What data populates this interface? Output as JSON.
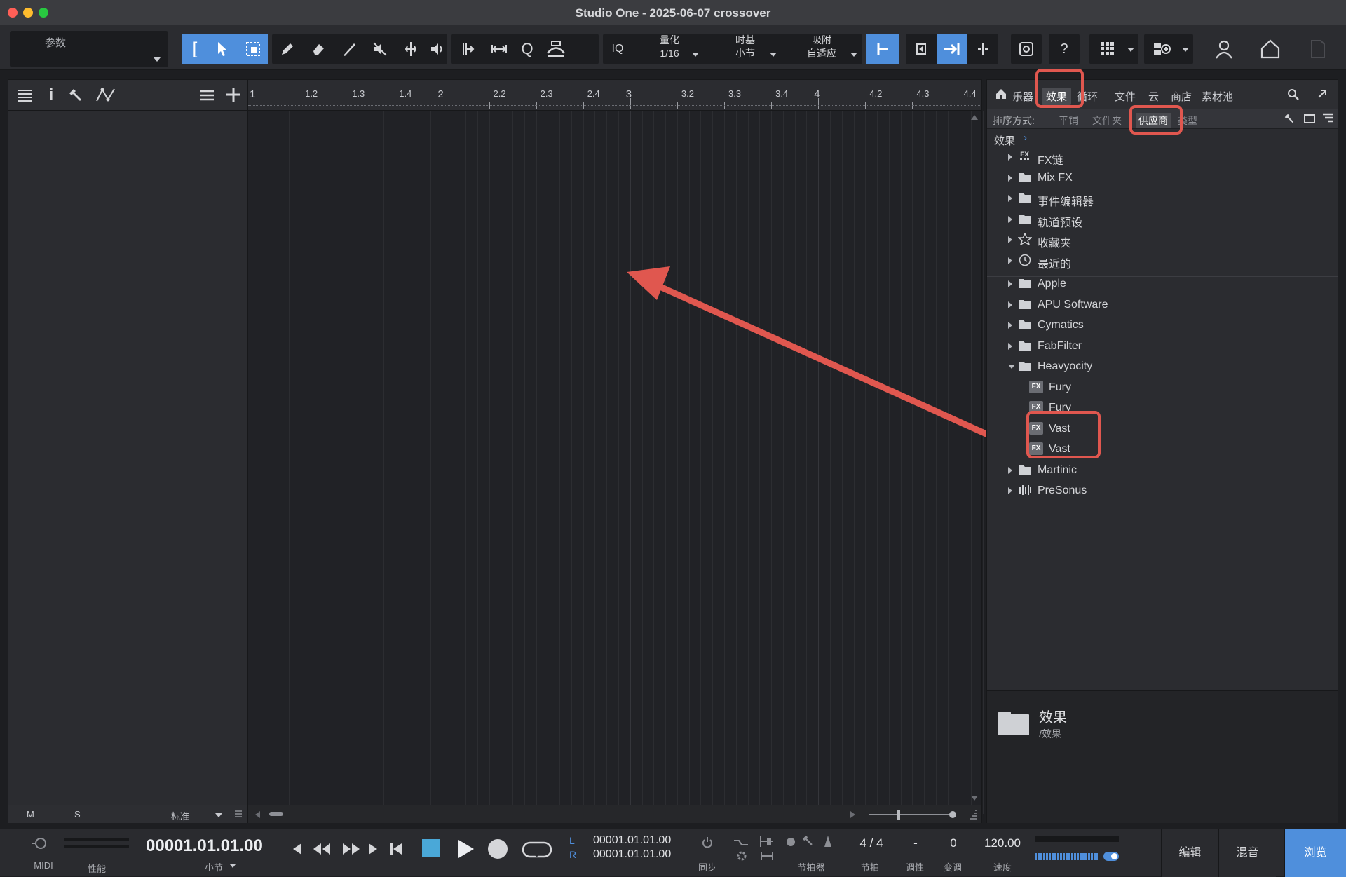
{
  "window": {
    "title": "Studio One - 2025-06-07 crossover"
  },
  "toolbar": {
    "params_label": "参数",
    "quantize_label": "量化",
    "quantize_value": "1/16",
    "timebase_label": "时基",
    "timebase_value": "小节",
    "snap_label": "吸附",
    "snap_value": "自适应",
    "iq_label": "IQ",
    "help_label": "?"
  },
  "ruler": {
    "labels": [
      "1",
      "1.2",
      "1.3",
      "1.4",
      "2",
      "2.2",
      "2.3",
      "2.4",
      "3",
      "3.2",
      "3.3",
      "3.4",
      "4",
      "4.2",
      "4.3",
      "4.4"
    ]
  },
  "left_footer": {
    "m": "M",
    "s": "S",
    "view": "标准"
  },
  "browser": {
    "tabs": [
      "乐器",
      "效果",
      "循环",
      "文件",
      "云",
      "商店",
      "素材池"
    ],
    "active_tab": "效果",
    "sort_label": "排序方式:",
    "sort_options": [
      "平铺",
      "文件夹",
      "供应商",
      "类型"
    ],
    "active_sort": "供应商",
    "breadcrumb": "效果",
    "items": [
      {
        "label": "FX链",
        "icon": "fx-chain-icon",
        "indent": 0,
        "expand": "closed"
      },
      {
        "label": "Mix FX",
        "icon": "folder-icon",
        "indent": 0,
        "expand": "closed"
      },
      {
        "label": "事件编辑器",
        "icon": "folder-icon",
        "indent": 0,
        "expand": "closed"
      },
      {
        "label": "轨道预设",
        "icon": "folder-icon",
        "indent": 0,
        "expand": "closed"
      },
      {
        "label": "收藏夹",
        "icon": "star-icon",
        "indent": 0,
        "expand": "closed"
      },
      {
        "label": "最近的",
        "icon": "clock-icon",
        "indent": 0,
        "expand": "closed"
      },
      {
        "label": "Apple",
        "icon": "folder-icon",
        "indent": 0,
        "expand": "closed"
      },
      {
        "label": "APU Software",
        "icon": "folder-icon",
        "indent": 0,
        "expand": "closed"
      },
      {
        "label": "Cymatics",
        "icon": "folder-icon",
        "indent": 0,
        "expand": "closed"
      },
      {
        "label": "FabFilter",
        "icon": "folder-icon",
        "indent": 0,
        "expand": "closed"
      },
      {
        "label": "Heavyocity",
        "icon": "folder-open-icon",
        "indent": 0,
        "expand": "open"
      },
      {
        "label": "Fury",
        "icon": "fx-plugin-icon",
        "indent": 1,
        "expand": "none"
      },
      {
        "label": "Fury",
        "icon": "fx-plugin-icon",
        "indent": 1,
        "expand": "none"
      },
      {
        "label": "Vast",
        "icon": "fx-plugin-icon",
        "indent": 1,
        "expand": "none"
      },
      {
        "label": "Vast",
        "icon": "fx-plugin-icon",
        "indent": 1,
        "expand": "none"
      },
      {
        "label": "Martinic",
        "icon": "folder-icon",
        "indent": 0,
        "expand": "closed"
      },
      {
        "label": "PreSonus",
        "icon": "presonus-icon",
        "indent": 0,
        "expand": "closed"
      }
    ],
    "info": {
      "title": "效果",
      "path": "/效果"
    }
  },
  "transport": {
    "midi": "MIDI",
    "performance": "性能",
    "time": "00001.01.01.00",
    "time_unit": "小节",
    "loop_l": "00001.01.01.00",
    "loop_r": "00001.01.01.00",
    "l": "L",
    "r": "R",
    "sync": "同步",
    "metronome": "节拍器",
    "signature": "4 / 4",
    "signature_label": "节拍",
    "key": "-",
    "key_label": "调性",
    "transpose": "0",
    "transpose_label": "变调",
    "tempo": "120.00",
    "tempo_label": "速度",
    "views": [
      "编辑",
      "混音",
      "浏览"
    ],
    "active_view": "浏览"
  },
  "colors": {
    "accent": "#4f8fdc",
    "highlight": "#e0574f"
  }
}
